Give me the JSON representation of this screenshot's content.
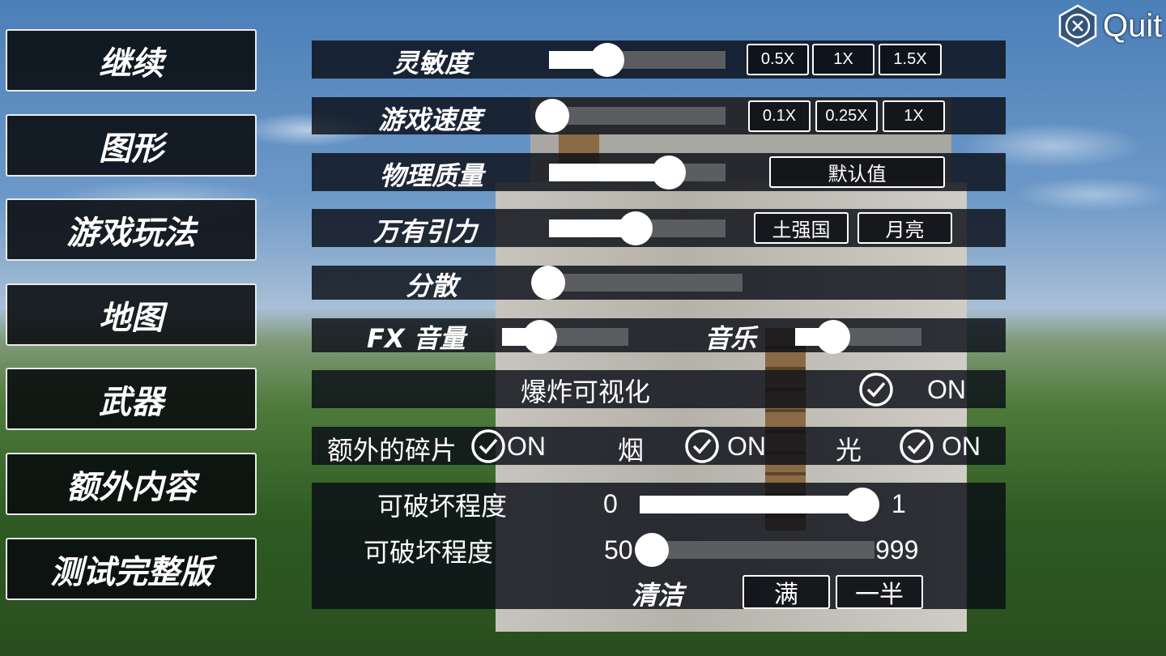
{
  "quit": {
    "label": "Quit",
    "icon": "close-hex-icon"
  },
  "menu": [
    {
      "label": "继续"
    },
    {
      "label": "图形"
    },
    {
      "label": "游戏玩法"
    },
    {
      "label": "地图"
    },
    {
      "label": "武器"
    },
    {
      "label": "额外内容"
    },
    {
      "label": "测试完整版"
    }
  ],
  "settings": {
    "sensitivity": {
      "label": "灵敏度",
      "value": 0.33,
      "presets": [
        "0.5X",
        "1X",
        "1.5X"
      ]
    },
    "game_speed": {
      "label": "游戏速度",
      "value": 0.02,
      "presets": [
        "0.1X",
        "0.25X",
        "1X"
      ]
    },
    "physics_quality": {
      "label": "物理质量",
      "value": 0.68,
      "default_label": "默认值"
    },
    "gravity": {
      "label": "万有引力",
      "value": 0.49,
      "presets": [
        "土强国",
        "月亮"
      ]
    },
    "dispersion": {
      "label": "分散",
      "value": 0.0
    },
    "fx_volume": {
      "label": "FX 音量",
      "value": 0.3
    },
    "music": {
      "label": "音乐",
      "value": 0.3
    },
    "explosion_visual": {
      "label": "爆炸可视化",
      "checked": true,
      "state": "ON"
    },
    "extra_debris": {
      "label": "额外的碎片",
      "checked": true,
      "state": "ON"
    },
    "smoke": {
      "label": "烟",
      "checked": true,
      "state": "ON"
    },
    "light": {
      "label": "光",
      "checked": true,
      "state": "ON"
    },
    "destructibility_1": {
      "label": "可破坏程度",
      "min": "0",
      "max": "1",
      "value": 0.99
    },
    "destructibility_2": {
      "label": "可破坏程度",
      "min": "50",
      "max": "999",
      "value": 0.05
    },
    "cleanup": {
      "label": "清洁",
      "full": "满",
      "half": "一半"
    }
  }
}
